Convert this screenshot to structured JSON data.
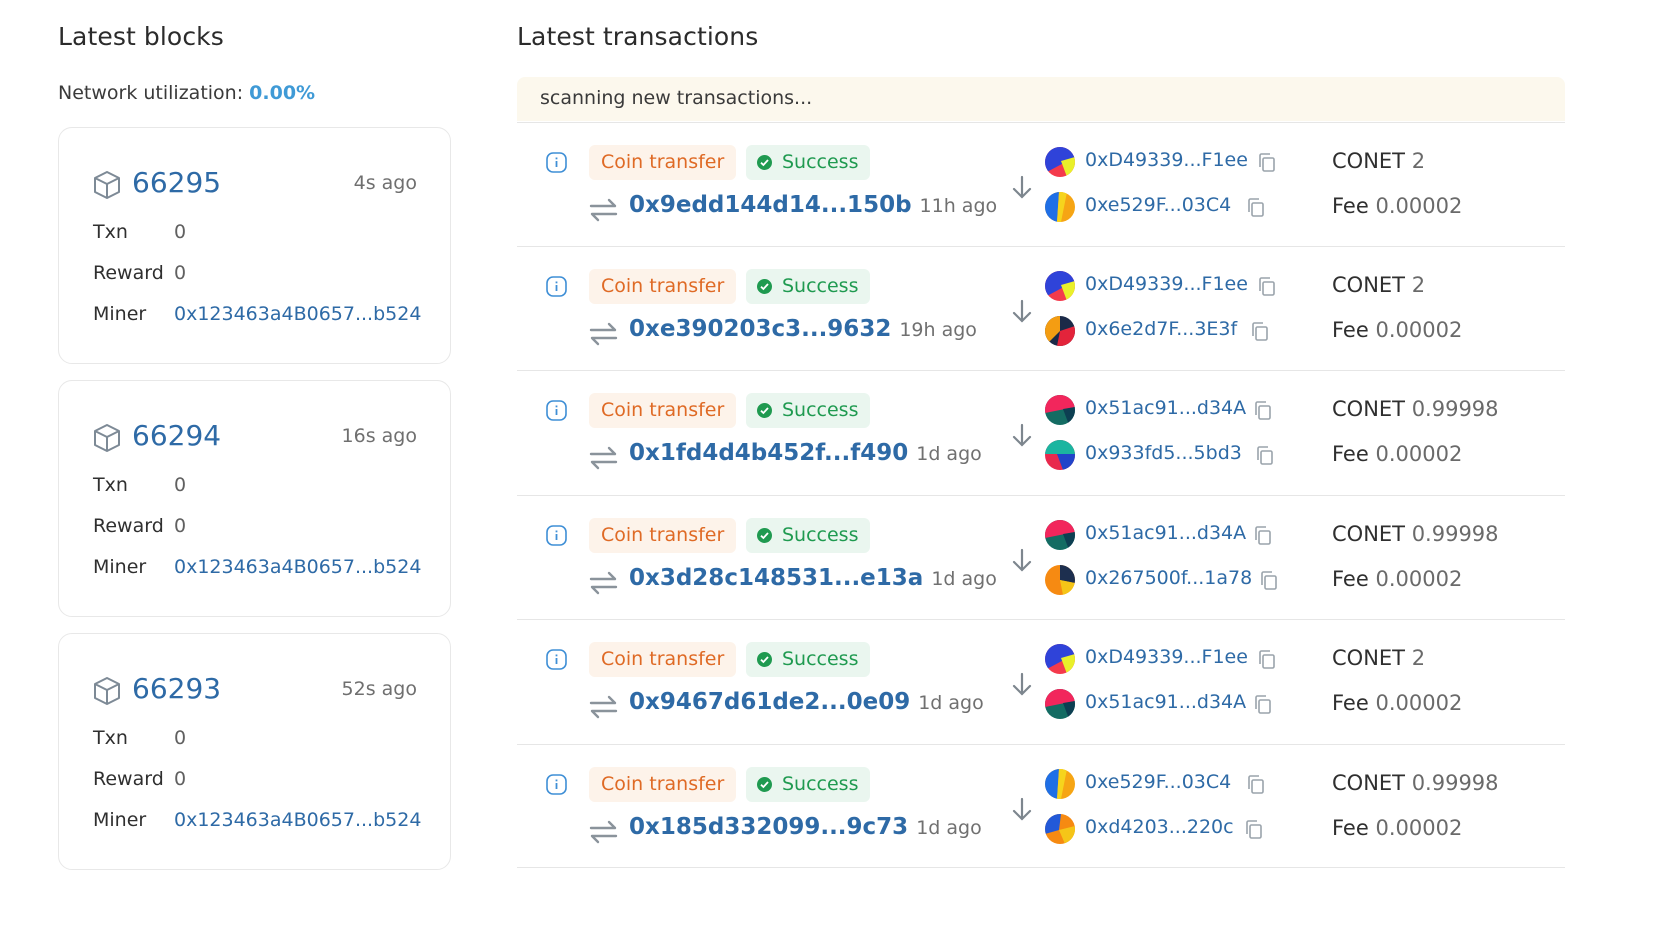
{
  "blocks": {
    "title": "Latest blocks",
    "network_label": "Network utilization:",
    "network_value": "0.00%",
    "items": [
      {
        "number": "66295",
        "ago": "4s ago",
        "txn_label": "Txn",
        "txn": "0",
        "reward_label": "Reward",
        "reward": "0",
        "miner_label": "Miner",
        "miner": "0x123463a4B0657...b524"
      },
      {
        "number": "66294",
        "ago": "16s ago",
        "txn_label": "Txn",
        "txn": "0",
        "reward_label": "Reward",
        "reward": "0",
        "miner_label": "Miner",
        "miner": "0x123463a4B0657...b524"
      },
      {
        "number": "66293",
        "ago": "52s ago",
        "txn_label": "Txn",
        "txn": "0",
        "reward_label": "Reward",
        "reward": "0",
        "miner_label": "Miner",
        "miner": "0x123463a4B0657...b524"
      }
    ]
  },
  "transactions": {
    "title": "Latest transactions",
    "scanning": "scanning new transactions...",
    "items": [
      {
        "type": "Coin transfer",
        "status": "Success",
        "hash": "0x9edd144d14...150b",
        "ago": "11h ago",
        "from": "0xD49339...F1ee",
        "to": "0xe529F...03C4",
        "value_label": "CONET",
        "value": "2",
        "fee_label": "Fee",
        "fee": "0.00002"
      },
      {
        "type": "Coin transfer",
        "status": "Success",
        "hash": "0xe390203c3...9632",
        "ago": "19h ago",
        "from": "0xD49339...F1ee",
        "to": "0x6e2d7F...3E3f",
        "value_label": "CONET",
        "value": "2",
        "fee_label": "Fee",
        "fee": "0.00002"
      },
      {
        "type": "Coin transfer",
        "status": "Success",
        "hash": "0x1fd4d4b452f...f490",
        "ago": "1d ago",
        "from": "0x51ac91...d34A",
        "to": "0x933fd5...5bd3",
        "value_label": "CONET",
        "value": "0.99998",
        "fee_label": "Fee",
        "fee": "0.00002"
      },
      {
        "type": "Coin transfer",
        "status": "Success",
        "hash": "0x3d28c148531...e13a",
        "ago": "1d ago",
        "from": "0x51ac91...d34A",
        "to": "0x267500f...1a78",
        "value_label": "CONET",
        "value": "0.99998",
        "fee_label": "Fee",
        "fee": "0.00002"
      },
      {
        "type": "Coin transfer",
        "status": "Success",
        "hash": "0x9467d61de2...0e09",
        "ago": "1d ago",
        "from": "0xD49339...F1ee",
        "to": "0x51ac91...d34A",
        "value_label": "CONET",
        "value": "2",
        "fee_label": "Fee",
        "fee": "0.00002"
      },
      {
        "type": "Coin transfer",
        "status": "Success",
        "hash": "0x185d332099...9c73",
        "ago": "1d ago",
        "from": "0xe529F...03C4",
        "to": "0xd4203...220c",
        "value_label": "CONET",
        "value": "0.99998",
        "fee_label": "Fee",
        "fee": "0.00002"
      }
    ]
  },
  "icons": {
    "block": "cube-icon",
    "info": "info-icon",
    "status": "check-circle-icon",
    "tx": "swap-arrows-icon",
    "direction": "arrow-down-icon",
    "copy": "copy-icon",
    "address": "identicon-avatar"
  },
  "colors": {
    "link": "#2e6aa6",
    "utilization": "#3f9ad6",
    "pill_type_bg": "#fdf3ea",
    "pill_type_text": "#df6a25",
    "pill_status_bg": "#eaf6ef",
    "pill_status_text": "#1f9a50",
    "scanning_bg": "#fcf8ed"
  }
}
